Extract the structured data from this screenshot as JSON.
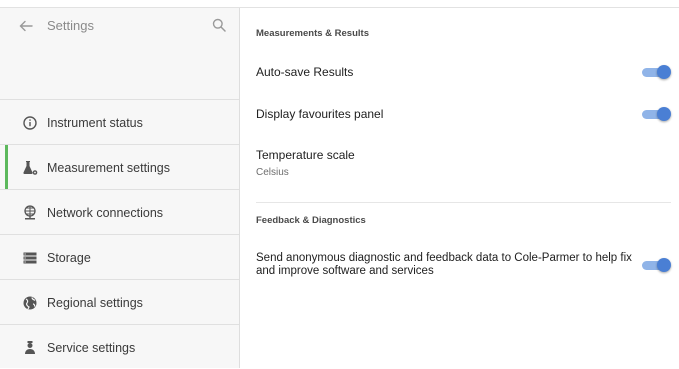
{
  "sidebar": {
    "title": "Settings",
    "items": [
      {
        "label": "Instrument status",
        "icon": "info-icon",
        "active": false
      },
      {
        "label": "Measurement settings",
        "icon": "flask-gear-icon",
        "active": true
      },
      {
        "label": "Network connections",
        "icon": "ethernet-icon",
        "active": false
      },
      {
        "label": "Storage",
        "icon": "storage-icon",
        "active": false
      },
      {
        "label": "Regional settings",
        "icon": "globe-icon",
        "active": false
      },
      {
        "label": "Service settings",
        "icon": "technician-icon",
        "active": false
      }
    ]
  },
  "main": {
    "measurements": {
      "section_title": "Measurements & Results",
      "autosave_label": "Auto-save Results",
      "autosave_on": true,
      "favourites_label": "Display favourites panel",
      "favourites_on": true,
      "temp_label": "Temperature scale",
      "temp_value": "Celsius"
    },
    "feedback": {
      "section_title": "Feedback & Diagnostics",
      "diag_text": "Send anonymous diagnostic and feedback data to Cole-Parmer to help fix and improve software and services",
      "diag_on": true
    }
  },
  "colors": {
    "accent_active": "#5cb85c",
    "toggle_thumb": "#4a7fd4",
    "toggle_track": "#90b4e8"
  }
}
